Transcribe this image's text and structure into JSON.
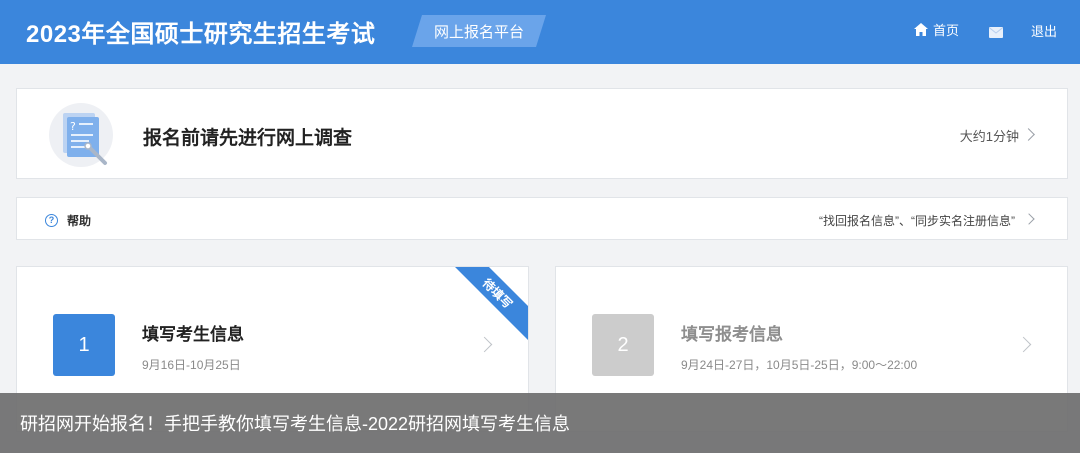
{
  "header": {
    "site_title": "2023年全国硕士研究生招生考试",
    "platform_badge": "网上报名平台",
    "nav": {
      "home": "首页",
      "logout": "退出"
    }
  },
  "survey": {
    "title": "报名前请先进行网上调查",
    "duration": "大约1分钟"
  },
  "help": {
    "label": "帮助",
    "links": "“找回报名信息”、“同步实名注册信息”"
  },
  "steps": [
    {
      "number": "1",
      "title": "填写考生信息",
      "date": "9月16日-10月25日",
      "ribbon": "待填写"
    },
    {
      "number": "2",
      "title": "填写报考信息",
      "date": "9月24日-27日，10月5日-25日，9:00～22:00"
    }
  ],
  "caption": "研招网开始报名！手把手教你填写考生信息-2022研招网填写考生信息",
  "colors": {
    "brand": "#3b86dc",
    "badge": "#6aa4ea",
    "disabled": "#cccccc"
  }
}
